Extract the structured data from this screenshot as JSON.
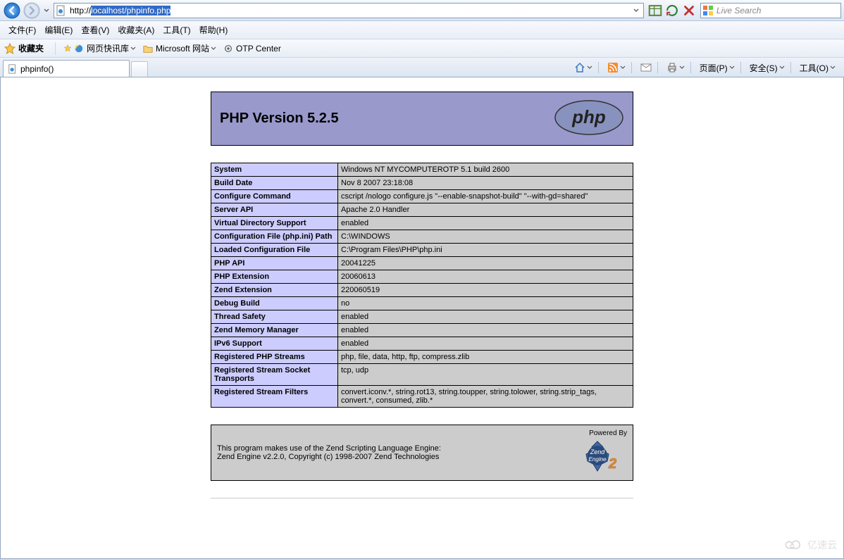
{
  "nav": {
    "url": "http://localhost/phpinfo.php",
    "url_prefix": "http://",
    "url_selected": "localhost/phpinfo.php"
  },
  "search": {
    "placeholder": "Live Search"
  },
  "menu": {
    "file": "文件(F)",
    "edit": "编辑(E)",
    "view": "查看(V)",
    "favorites": "收藏夹(A)",
    "tools": "工具(T)",
    "help": "帮助(H)"
  },
  "favbar": {
    "label": "收藏夹",
    "items": [
      {
        "name": "网页快讯库"
      },
      {
        "name": "Microsoft 网站"
      },
      {
        "name": "OTP Center"
      }
    ]
  },
  "tab": {
    "title": "phpinfo()"
  },
  "tabtools": {
    "page": "页面(P)",
    "safety": "安全(S)",
    "tools": "工具(O)"
  },
  "php": {
    "title": "PHP Version 5.2.5",
    "table": [
      {
        "k": "System",
        "v": "Windows NT MYCOMPUTEROTP 5.1 build 2600"
      },
      {
        "k": "Build Date",
        "v": "Nov 8 2007 23:18:08"
      },
      {
        "k": "Configure Command",
        "v": "cscript /nologo configure.js \"--enable-snapshot-build\" \"--with-gd=shared\""
      },
      {
        "k": "Server API",
        "v": "Apache 2.0 Handler"
      },
      {
        "k": "Virtual Directory Support",
        "v": "enabled"
      },
      {
        "k": "Configuration File (php.ini) Path",
        "v": "C:\\WINDOWS"
      },
      {
        "k": "Loaded Configuration File",
        "v": "C:\\Program Files\\PHP\\php.ini"
      },
      {
        "k": "PHP API",
        "v": "20041225"
      },
      {
        "k": "PHP Extension",
        "v": "20060613"
      },
      {
        "k": "Zend Extension",
        "v": "220060519"
      },
      {
        "k": "Debug Build",
        "v": "no"
      },
      {
        "k": "Thread Safety",
        "v": "enabled"
      },
      {
        "k": "Zend Memory Manager",
        "v": "enabled"
      },
      {
        "k": "IPv6 Support",
        "v": "enabled"
      },
      {
        "k": "Registered PHP Streams",
        "v": "php, file, data, http, ftp, compress.zlib"
      },
      {
        "k": "Registered Stream Socket Transports",
        "v": "tcp, udp"
      },
      {
        "k": "Registered Stream Filters",
        "v": "convert.iconv.*, string.rot13, string.toupper, string.tolower, string.strip_tags, convert.*, consumed, zlib.*"
      }
    ],
    "zend_line1": "This program makes use of the Zend Scripting Language Engine:",
    "zend_line2": "Zend Engine v2.2.0, Copyright (c) 1998-2007 Zend Technologies",
    "zend_powered": "Powered By"
  },
  "watermark": {
    "text": "亿速云"
  }
}
